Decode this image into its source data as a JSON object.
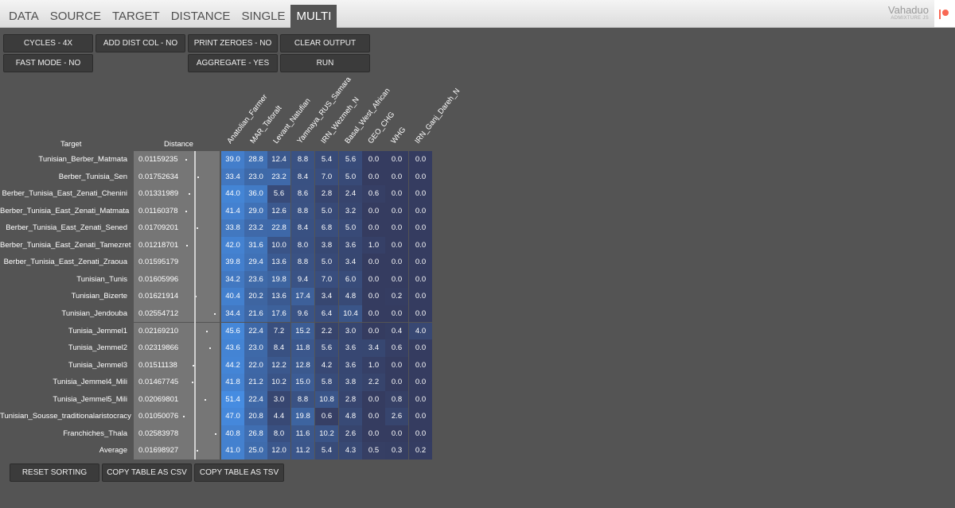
{
  "nav": {
    "tabs": [
      {
        "label": "DATA",
        "active": false
      },
      {
        "label": "SOURCE",
        "active": false
      },
      {
        "label": "TARGET",
        "active": false
      },
      {
        "label": "DISTANCE",
        "active": false
      },
      {
        "label": "SINGLE",
        "active": false
      },
      {
        "label": "MULTI",
        "active": true
      }
    ],
    "brand_title": "Vahaduo",
    "brand_subtitle": "ADMIXTURE JS"
  },
  "options": {
    "cycles": "CYCLES - 4X",
    "add_dist_col": "ADD DIST COL - NO",
    "print_zeroes": "PRINT ZEROES - NO",
    "clear_output": "CLEAR OUTPUT",
    "fast_mode": "FAST MODE - NO",
    "aggregate": "AGGREGATE - YES",
    "run": "RUN"
  },
  "table": {
    "target_header": "Target",
    "distance_header": "Distance",
    "columns": [
      "Anatolian_Farmer",
      "MAR_Taforalt",
      "Levant_Natufian",
      "Yamnaya_RUS_Samara",
      "IRN_Wezmeh_N",
      "Basal_West_African",
      "GEO_CHG",
      "WHG",
      "IRN_Ganj_Dareh_N"
    ],
    "rows": [
      {
        "name": "Tunisian_Berber_Matmata",
        "distance": "0.01159235",
        "values": [
          "39.0",
          "28.8",
          "12.4",
          "8.8",
          "5.4",
          "5.6",
          "0.0",
          "0.0",
          "0.0"
        ]
      },
      {
        "name": "Berber_Tunisia_Sen",
        "distance": "0.01752634",
        "values": [
          "33.4",
          "23.0",
          "23.2",
          "8.4",
          "7.0",
          "5.0",
          "0.0",
          "0.0",
          "0.0"
        ]
      },
      {
        "name": "Berber_Tunisia_East_Zenati_Chenini",
        "distance": "0.01331989",
        "values": [
          "44.0",
          "36.0",
          "5.6",
          "8.6",
          "2.8",
          "2.4",
          "0.6",
          "0.0",
          "0.0"
        ]
      },
      {
        "name": "Berber_Tunisia_East_Zenati_Matmata",
        "distance": "0.01160378",
        "values": [
          "41.4",
          "29.0",
          "12.6",
          "8.8",
          "5.0",
          "3.2",
          "0.0",
          "0.0",
          "0.0"
        ]
      },
      {
        "name": "Berber_Tunisia_East_Zenati_Sened",
        "distance": "0.01709201",
        "values": [
          "33.8",
          "23.2",
          "22.8",
          "8.4",
          "6.8",
          "5.0",
          "0.0",
          "0.0",
          "0.0"
        ]
      },
      {
        "name": "Berber_Tunisia_East_Zenati_Tamezret",
        "distance": "0.01218701",
        "values": [
          "42.0",
          "31.6",
          "10.0",
          "8.0",
          "3.8",
          "3.6",
          "1.0",
          "0.0",
          "0.0"
        ]
      },
      {
        "name": "Berber_Tunisia_East_Zenati_Zraoua",
        "distance": "0.01595179",
        "values": [
          "39.8",
          "29.4",
          "13.6",
          "8.8",
          "5.0",
          "3.4",
          "0.0",
          "0.0",
          "0.0"
        ]
      },
      {
        "name": "Tunisian_Tunis",
        "distance": "0.01605996",
        "values": [
          "34.2",
          "23.6",
          "19.8",
          "9.4",
          "7.0",
          "6.0",
          "0.0",
          "0.0",
          "0.0"
        ]
      },
      {
        "name": "Tunisian_Bizerte",
        "distance": "0.01621914",
        "values": [
          "40.4",
          "20.2",
          "13.6",
          "17.4",
          "3.4",
          "4.8",
          "0.0",
          "0.2",
          "0.0"
        ]
      },
      {
        "name": "Tunisian_Jendouba",
        "distance": "0.02554712",
        "values": [
          "34.4",
          "21.6",
          "17.6",
          "9.6",
          "6.4",
          "10.4",
          "0.0",
          "0.0",
          "0.0"
        ]
      },
      {
        "name": "Tunisia_Jemmel1",
        "distance": "0.02169210",
        "values": [
          "45.6",
          "22.4",
          "7.2",
          "15.2",
          "2.2",
          "3.0",
          "0.0",
          "0.4",
          "4.0"
        ]
      },
      {
        "name": "Tunisia_Jemmel2",
        "distance": "0.02319866",
        "values": [
          "43.6",
          "23.0",
          "8.4",
          "11.8",
          "5.6",
          "3.6",
          "3.4",
          "0.6",
          "0.0"
        ]
      },
      {
        "name": "Tunisia_Jemmel3",
        "distance": "0.01511138",
        "values": [
          "44.2",
          "22.0",
          "12.2",
          "12.8",
          "4.2",
          "3.6",
          "1.0",
          "0.0",
          "0.0"
        ]
      },
      {
        "name": "Tunisia_Jemmel4_Mili",
        "distance": "0.01467745",
        "values": [
          "41.8",
          "21.2",
          "10.2",
          "15.0",
          "5.8",
          "3.8",
          "2.2",
          "0.0",
          "0.0"
        ]
      },
      {
        "name": "Tunisia_Jemmel5_Mili",
        "distance": "0.02069801",
        "values": [
          "51.4",
          "22.4",
          "3.0",
          "8.8",
          "10.8",
          "2.8",
          "0.0",
          "0.8",
          "0.0"
        ]
      },
      {
        "name": "Tunisian_Sousse_traditionalaristocracy",
        "distance": "0.01050076",
        "values": [
          "47.0",
          "20.8",
          "4.4",
          "19.8",
          "0.6",
          "4.8",
          "0.0",
          "2.6",
          "0.0"
        ]
      },
      {
        "name": "Franchiches_Thala",
        "distance": "0.02583978",
        "values": [
          "40.8",
          "26.8",
          "8.0",
          "11.6",
          "10.2",
          "2.6",
          "0.0",
          "0.0",
          "0.0"
        ]
      },
      {
        "name": "Average",
        "distance": "0.01698927",
        "values": [
          "41.0",
          "25.0",
          "12.0",
          "11.2",
          "5.4",
          "4.3",
          "0.5",
          "0.3",
          "0.2"
        ]
      }
    ]
  },
  "bottom": {
    "reset_sorting": "RESET SORTING",
    "copy_csv": "COPY TABLE AS CSV",
    "copy_tsv": "COPY TABLE AS TSV"
  }
}
